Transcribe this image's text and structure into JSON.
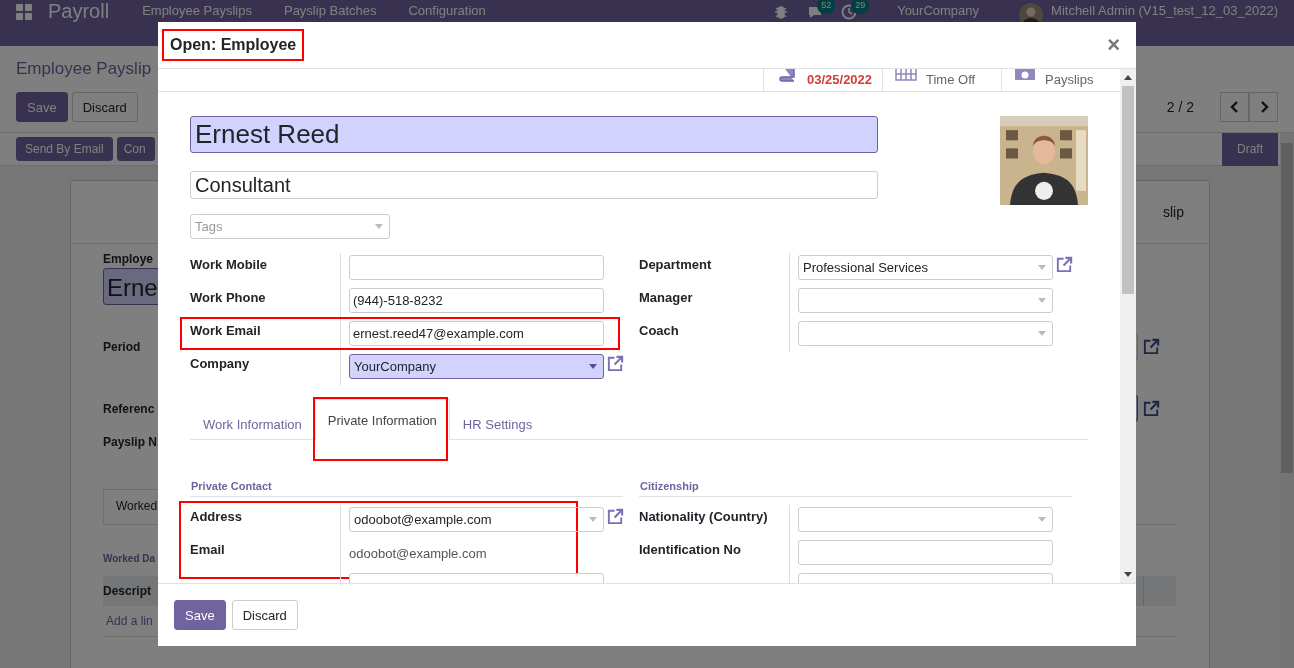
{
  "navbar": {
    "app_title": "Payroll",
    "menu": [
      "Employee Payslips",
      "Payslip Batches",
      "Configuration"
    ],
    "chat_count": "52",
    "activity_count": "29",
    "company": "YourCompany",
    "user": "Mitchell Admin (V15_test_12_03_2022)"
  },
  "control_panel": {
    "breadcrumb": "Employee Payslip",
    "buttons": [
      "Save",
      "Discard"
    ],
    "pager": "2 / 2"
  },
  "status_bar": {
    "buttons": [
      "Send By Email",
      "Con"
    ],
    "state": "Draft"
  },
  "sheet": {
    "header_button": "slip",
    "employee_label": "Employe",
    "employee_value": "Erne",
    "labels": [
      "Period",
      "Referenc",
      "Payslip N"
    ],
    "notebook_tab": "Worked",
    "section_title": "Worked Da",
    "column": "Descript",
    "add_line": "Add a lin"
  },
  "dialog": {
    "title": "Open: Employee",
    "close": "×",
    "stat_buttons": [
      {
        "kind": "date",
        "text": "03/25/2022"
      },
      {
        "kind": "calendar",
        "text": "Time Off"
      },
      {
        "kind": "money",
        "text": "Payslips"
      }
    ],
    "name": "Ernest Reed",
    "job_title": "Consultant",
    "tags_placeholder": "Tags",
    "left_fields": [
      {
        "label": "Work Mobile",
        "kind": "input",
        "required": false,
        "link": false,
        "highlighted": false
      },
      {
        "label": "Work Phone",
        "kind": "input",
        "value": "(944)-518-8232",
        "required": false,
        "link": false,
        "highlighted": false
      },
      {
        "label": "Work Email",
        "kind": "input",
        "value": "ernest.reed47@example.com",
        "required": false,
        "link": false,
        "highlighted": true
      },
      {
        "label": "Company",
        "kind": "select",
        "value": "YourCompany",
        "required": true,
        "link": true,
        "highlighted": false
      }
    ],
    "right_fields": [
      {
        "label": "Department",
        "kind": "select",
        "value": "Professional Services",
        "required": false,
        "link": true,
        "highlighted": false
      },
      {
        "label": "Manager",
        "kind": "select",
        "required": false,
        "link": false,
        "highlighted": false
      },
      {
        "label": "Coach",
        "kind": "select",
        "required": false,
        "link": false,
        "highlighted": false
      }
    ],
    "tabs": [
      {
        "label": "Work Information",
        "selected": false,
        "highlighted": false
      },
      {
        "label": "Private Information",
        "selected": true,
        "highlighted": true
      },
      {
        "label": "HR Settings",
        "selected": false,
        "highlighted": false
      }
    ],
    "private_contact": {
      "title": "Private Contact",
      "fields": [
        {
          "label": "Address",
          "kind": "select",
          "value": "odoobot@example.com",
          "required": false,
          "link": true,
          "highlighted": true
        },
        {
          "label": "Email",
          "kind": "text",
          "value": "odoobot@example.com",
          "required": false,
          "link": false,
          "highlighted": true
        },
        {
          "kind": "input",
          "required": false,
          "link": false,
          "highlighted": false
        }
      ]
    },
    "citizenship": {
      "title": "Citizenship",
      "fields": [
        {
          "label": "Nationality (Country)",
          "kind": "select",
          "required": false,
          "link": false,
          "highlighted": false
        },
        {
          "label": "Identification No",
          "kind": "input",
          "required": false,
          "link": false,
          "highlighted": false
        },
        {
          "kind": "input",
          "required": false,
          "link": false,
          "highlighted": false
        }
      ]
    },
    "footer_buttons": [
      "Save",
      "Discard"
    ]
  }
}
